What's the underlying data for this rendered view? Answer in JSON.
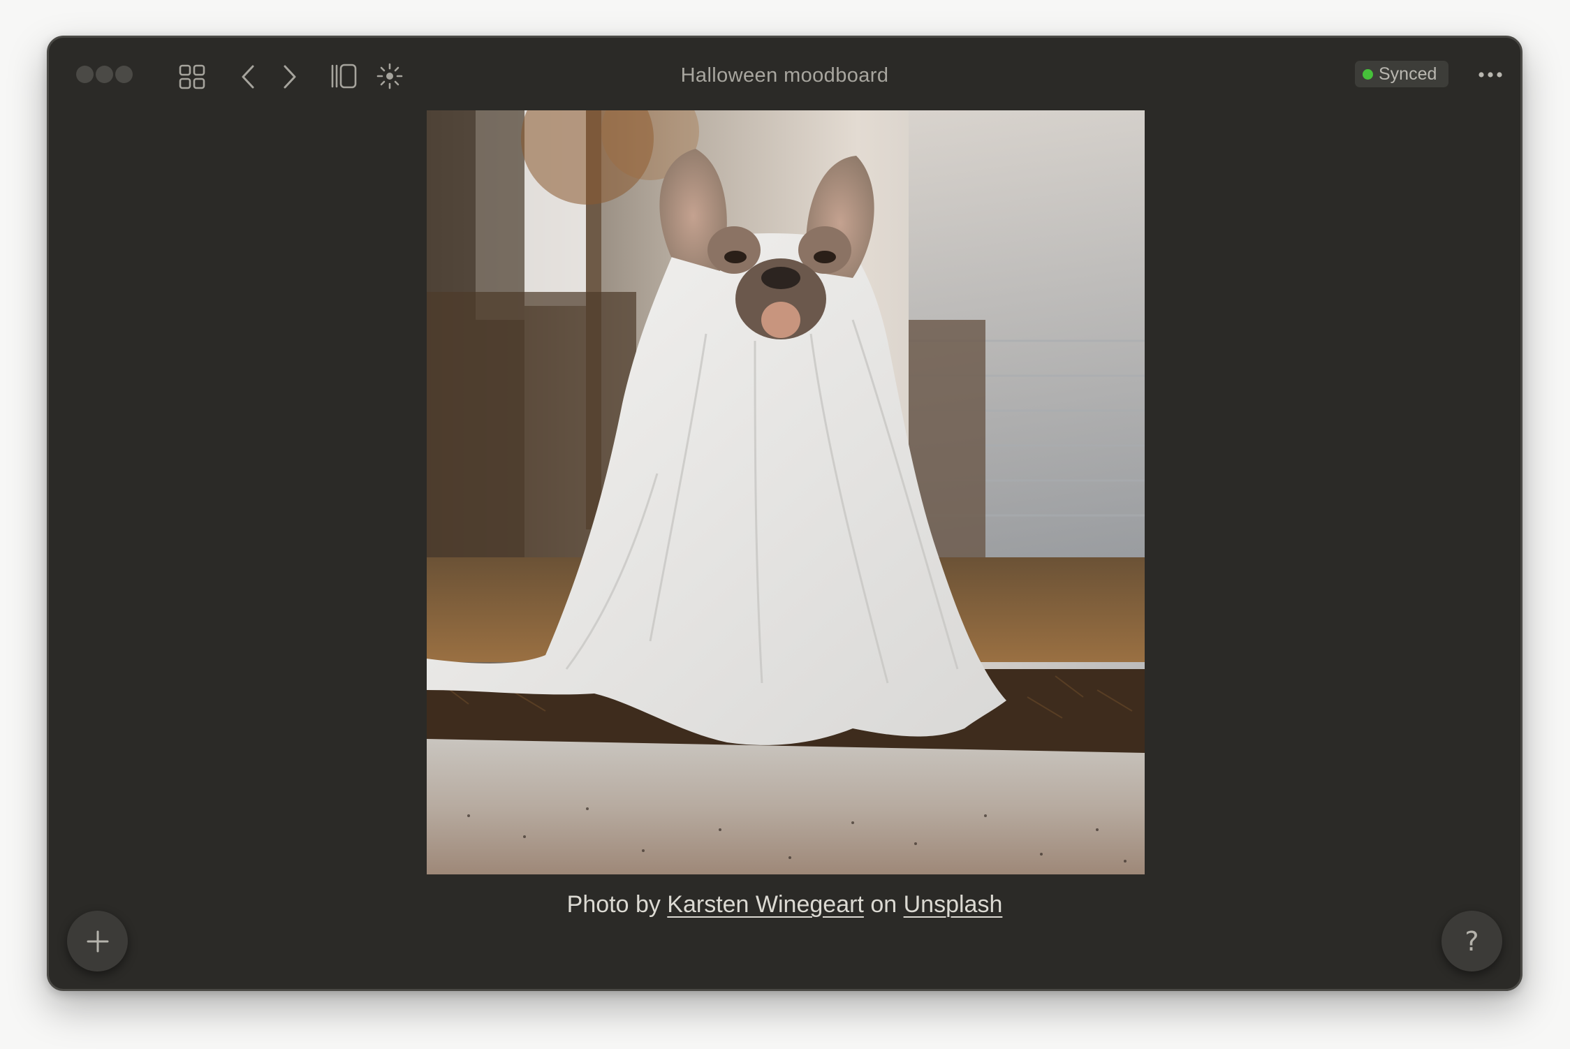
{
  "window": {
    "title": "Halloween moodboard",
    "sync_status": "Synced",
    "sync_color": "#46c13a"
  },
  "toolbar": {
    "icons": [
      "grid-icon",
      "chevron-left-icon",
      "chevron-right-icon",
      "sidebar-panel-icon",
      "brightness-icon",
      "more-options-icon"
    ]
  },
  "image": {
    "subject": "french bulldog dressed as ghost in white sheet"
  },
  "caption": {
    "prefix": "Photo by ",
    "author": "Karsten Winegeart",
    "middle": " on ",
    "source": "Unsplash"
  },
  "buttons": {
    "add_icon": "plus-icon",
    "help_label": "?"
  },
  "colors": {
    "window_bg": "#2b2a27",
    "page_bg": "#f7f7f6",
    "accent_green": "#46c13a"
  }
}
